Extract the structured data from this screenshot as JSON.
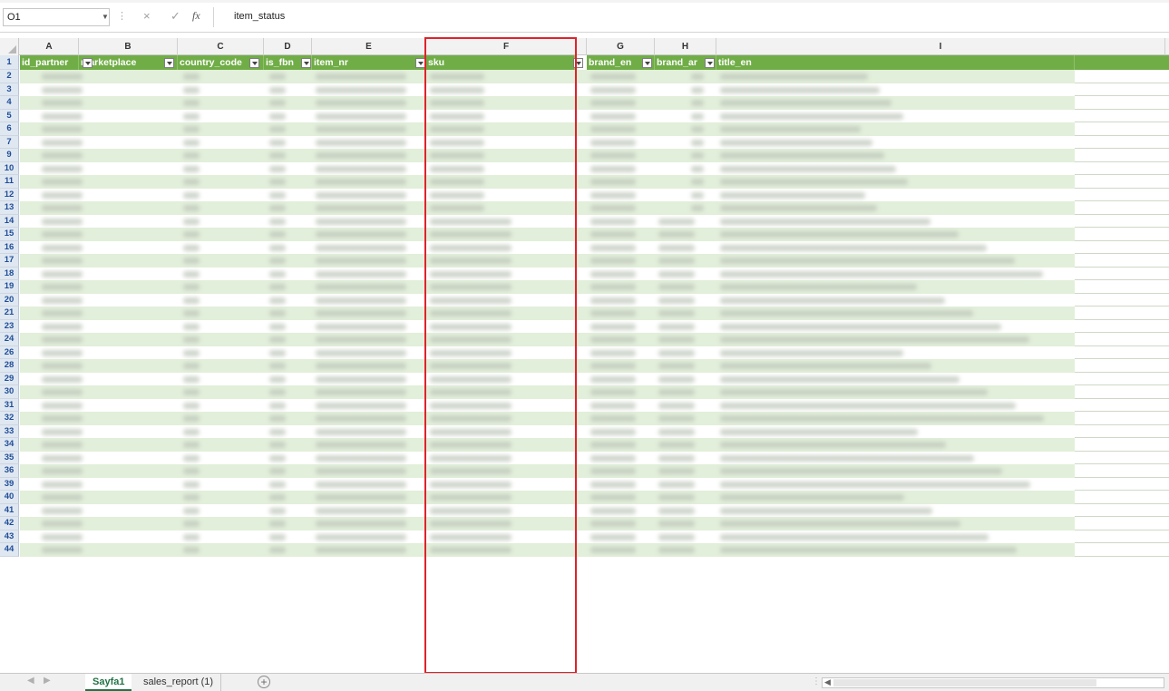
{
  "formula_bar": {
    "name_box": "O1",
    "fx": "fx",
    "formula": "item_status",
    "cancel_icon": "×",
    "enter_icon": "✓"
  },
  "columns": {
    "letters": [
      "A",
      "B",
      "C",
      "D",
      "E",
      "F",
      "G",
      "H",
      "I"
    ],
    "headers": [
      "id_partner",
      "marketplace",
      "country_code",
      "is_fbn",
      "item_nr",
      "sku",
      "brand_en",
      "brand_ar",
      "title_en"
    ]
  },
  "rows": {
    "numbers": [
      "1",
      "2",
      "3",
      "4",
      "5",
      "6",
      "7",
      "9",
      "10",
      "11",
      "12",
      "13",
      "14",
      "15",
      "16",
      "17",
      "18",
      "19",
      "20",
      "21",
      "23",
      "24",
      "26",
      "28",
      "29",
      "30",
      "31",
      "32",
      "33",
      "34",
      "35",
      "36",
      "39",
      "40",
      "41",
      "42",
      "43",
      "44"
    ]
  },
  "sheet_tabs": [
    "Sayfa1",
    "sales_report (1)"
  ],
  "colors": {
    "header_fill": "#70ad47",
    "band_light": "#e2efda",
    "highlight": "#e0222a",
    "active_tab": "#217346"
  },
  "icons": {
    "add_sheet": "⊕",
    "nav_prev": "◀",
    "nav_next": "▶",
    "filter": "filter-dropdown-icon"
  }
}
